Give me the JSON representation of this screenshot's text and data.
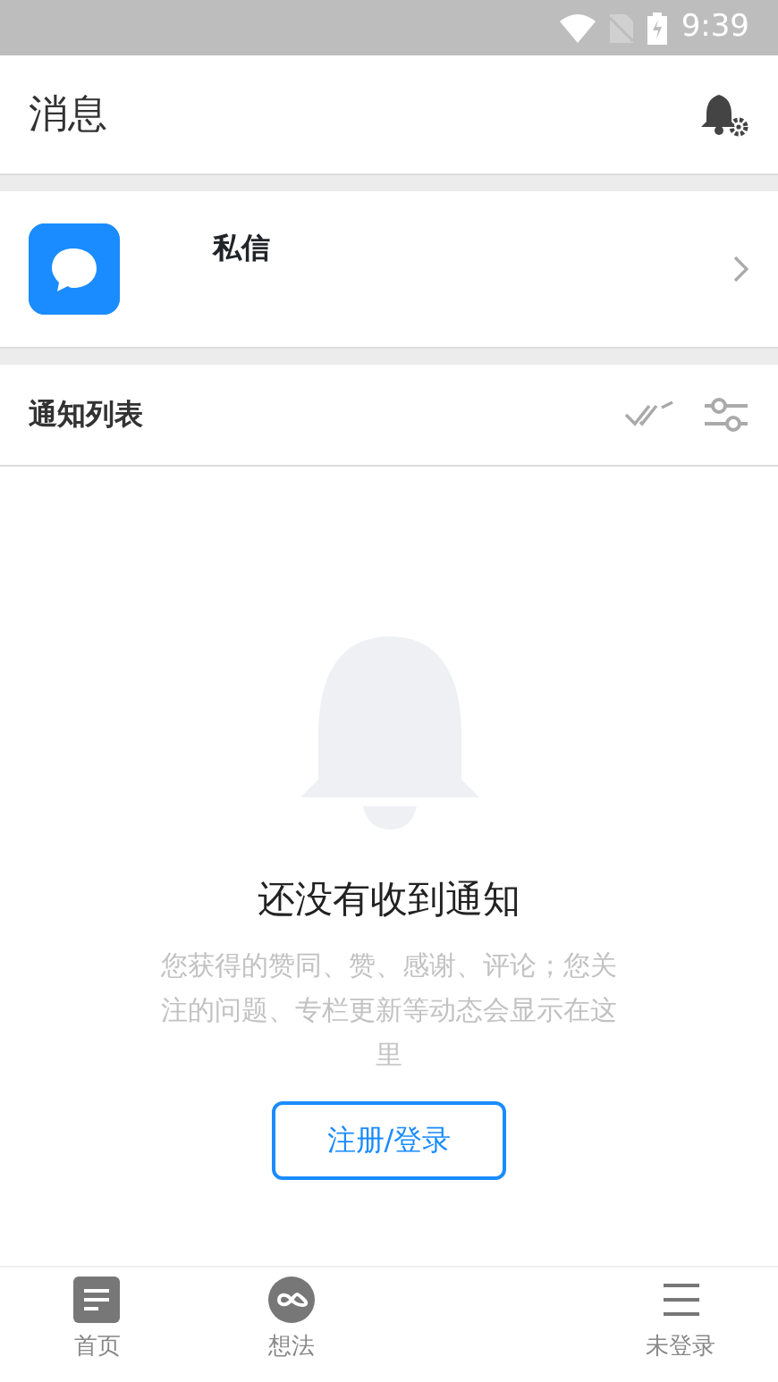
{
  "status_bar": {
    "time": "9:39"
  },
  "header": {
    "title": "消息"
  },
  "private_message": {
    "label": "私信"
  },
  "notification_list": {
    "title": "通知列表"
  },
  "empty_state": {
    "title": "还没有收到通知",
    "description": "您获得的赞同、赞、感谢、评论；您关注的问题、专栏更新等动态会显示在这里",
    "button": "注册/登录"
  },
  "bottom_nav": [
    {
      "label": "首页",
      "kind": "home"
    },
    {
      "label": "想法",
      "kind": "ideas"
    },
    {
      "label": "未登录",
      "kind": "profile"
    }
  ]
}
